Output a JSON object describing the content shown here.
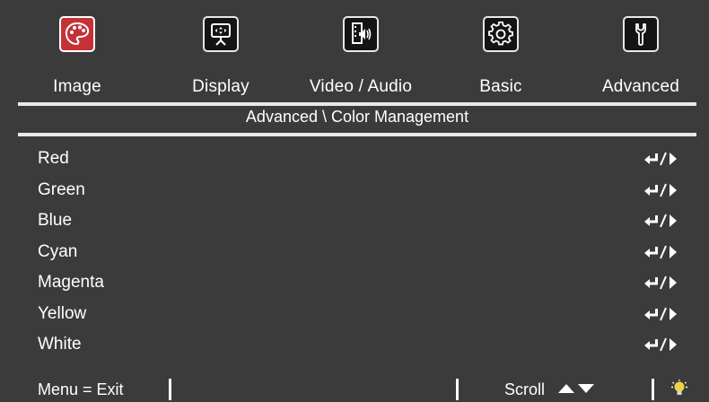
{
  "tabs": [
    {
      "label": "Image",
      "icon": "palette-icon",
      "active": true
    },
    {
      "label": "Display",
      "icon": "projector-screen-icon",
      "active": false
    },
    {
      "label": "Video / Audio",
      "icon": "video-audio-icon",
      "active": false
    },
    {
      "label": "Basic",
      "icon": "gear-settings-icon",
      "active": false
    },
    {
      "label": "Advanced",
      "icon": "wrench-icon",
      "active": false
    }
  ],
  "breadcrumb": "Advanced \\ Color Management",
  "rows": [
    {
      "label": "Red"
    },
    {
      "label": "Green"
    },
    {
      "label": "Blue"
    },
    {
      "label": "Cyan"
    },
    {
      "label": "Magenta"
    },
    {
      "label": "Yellow"
    },
    {
      "label": "White"
    }
  ],
  "footer": {
    "menu_exit": "Menu = Exit",
    "scroll": "Scroll"
  },
  "colors": {
    "background": "#3b3b3b",
    "active_tab": "#c43236",
    "rule": "#e9e9e9"
  }
}
